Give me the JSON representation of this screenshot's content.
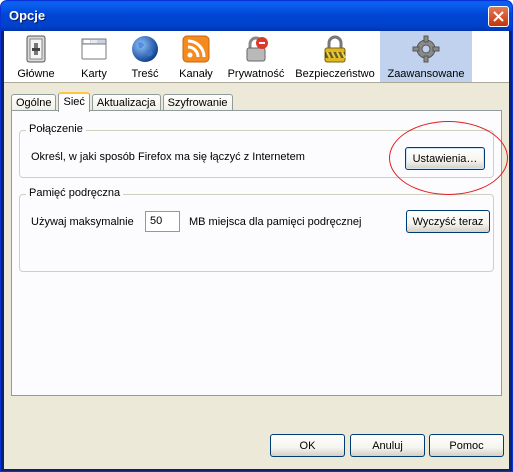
{
  "window": {
    "title": "Opcje"
  },
  "panes": [
    {
      "label": "Główne",
      "icon": "general-icon"
    },
    {
      "label": "Karty",
      "icon": "tabs-icon"
    },
    {
      "label": "Treść",
      "icon": "content-globe-icon"
    },
    {
      "label": "Kanały",
      "icon": "feeds-rss-icon"
    },
    {
      "label": "Prywatność",
      "icon": "privacy-icon"
    },
    {
      "label": "Bezpieczeństwo",
      "icon": "security-padlock-icon"
    },
    {
      "label": "Zaawansowane",
      "icon": "advanced-gear-icon",
      "selected": true
    }
  ],
  "tabs": [
    {
      "label": "Ogólne"
    },
    {
      "label": "Sieć",
      "active": true
    },
    {
      "label": "Aktualizacja"
    },
    {
      "label": "Szyfrowanie"
    }
  ],
  "connection": {
    "title": "Połączenie",
    "description": "Określ, w jaki sposób Firefox ma się łączyć z Internetem",
    "settings_button": "Ustawienia…"
  },
  "cache": {
    "title": "Pamięć podręczna",
    "use_max_label": "Używaj maksymalnie",
    "size_value": "50",
    "size_suffix": "MB miejsca dla pamięci podręcznej",
    "clear_button": "Wyczyść teraz"
  },
  "footer": {
    "ok": "OK",
    "cancel": "Anuluj",
    "help": "Pomoc"
  },
  "colors": {
    "titlebar": "#0046d5",
    "selected_pane": "#c1d2ee",
    "highlight_oval": "#e02020"
  }
}
